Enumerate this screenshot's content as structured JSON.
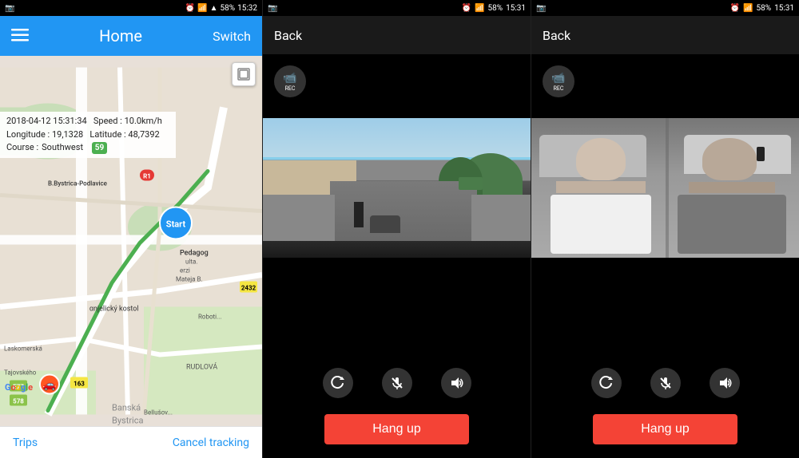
{
  "panel_map": {
    "status_bar": {
      "left_icon": "☰",
      "camera_icon": "📷",
      "time": "15:32",
      "battery": "58%",
      "signal_icons": "📶"
    },
    "top_bar": {
      "menu_label": "≡",
      "title": "Home",
      "switch_label": "Switch"
    },
    "info": {
      "datetime": "2018-04-12  15:31:34",
      "speed_label": "Speed :",
      "speed_value": "10.0km/h",
      "longitude_label": "Longitude :",
      "longitude_value": "19,1328",
      "latitude_label": "Latitude :",
      "latitude_value": "48,7392",
      "course_label": "Course :",
      "course_value": "Southwest",
      "speed_badge": "59"
    },
    "bottom_bar": {
      "trips_label": "Trips",
      "cancel_label": "Cancel tracking"
    }
  },
  "panel_camera_front": {
    "status_bar": {
      "camera_icon": "📷",
      "time": "15:31",
      "battery": "58%"
    },
    "top_bar": {
      "back_label": "Back"
    },
    "rec_label": "REC",
    "controls": {
      "rotate_icon": "↻",
      "mute_icon": "🎤",
      "volume_icon": "🔊"
    },
    "hang_up_label": "Hang up"
  },
  "panel_camera_interior": {
    "status_bar": {
      "camera_icon": "📷",
      "time": "15:31",
      "battery": "58%"
    },
    "top_bar": {
      "back_label": "Back"
    },
    "rec_label": "REC",
    "controls": {
      "rotate_icon": "↻",
      "mute_icon": "🎤",
      "volume_icon": "🔊"
    },
    "hang_up_label": "Hang up"
  },
  "colors": {
    "accent_blue": "#2196F3",
    "hang_up_red": "#F44336",
    "status_green": "#4CAF50",
    "dark_bg": "#000000",
    "panel_bg": "#1a1a1a"
  }
}
